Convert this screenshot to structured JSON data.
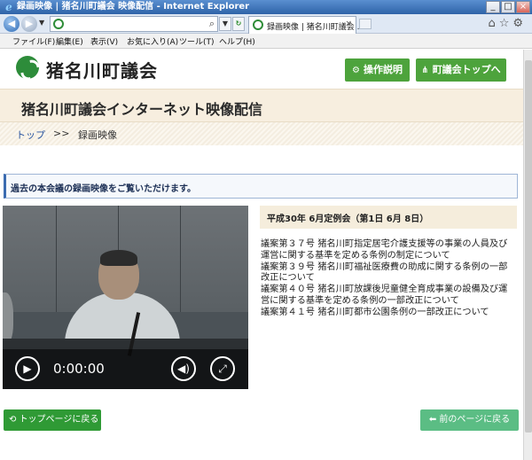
{
  "browser": {
    "window_title": "録画映像 | 猪名川町議会 映像配信 - Internet Explorer",
    "tab_label": "録画映像 | 猪名川町議会 ...",
    "menu": [
      "ファイル(F)",
      "編集(E)",
      "表示(V)",
      "お気に入り(A)",
      "ツール(T)",
      "ヘルプ(H)"
    ],
    "window_buttons": {
      "minimize": "_",
      "maximize": "□",
      "close": "×"
    },
    "icons": {
      "search": "⌕",
      "dropdown": "▼",
      "refresh": "↻",
      "close_tab": "×",
      "home_star_gear": "⌂☆⚙"
    }
  },
  "header": {
    "site_name": "猪名川町議会",
    "help_button": "操作説明",
    "top_button": "町議会トップへ"
  },
  "banner": {
    "title": "猪名川町議会インターネット映像配信"
  },
  "breadcrumb": {
    "home": "トップ",
    "separator": ">>",
    "current": "録画映像"
  },
  "intro_text": "過去の本会議の録画映像をご覧いただけます。",
  "player": {
    "time": "0:00:00"
  },
  "meeting": {
    "title": "平成30年 6月定例会（第1日 6月 8日）",
    "agenda_lines": [
      "議案第３７号 猪名川町指定居宅介護支援等の事業の人員及び",
      "運営に関する基準を定める条例の制定について",
      "議案第３９号 猪名川町福祉医療費の助成に関する条例の一部",
      "改正について",
      "議案第４０号 猪名川町放課後児童健全育成事業の設備及び運",
      "営に関する基準を定める条例の一部改正について",
      "議案第４１号 猪名川町都市公園条例の一部改正について"
    ]
  },
  "footer": {
    "back_top": "トップページに戻る",
    "prev_page": "前のページに戻る"
  },
  "colors": {
    "accent_green": "#4da33c",
    "banner_bg": "#f7eedf",
    "link_blue": "#2a55a0"
  }
}
